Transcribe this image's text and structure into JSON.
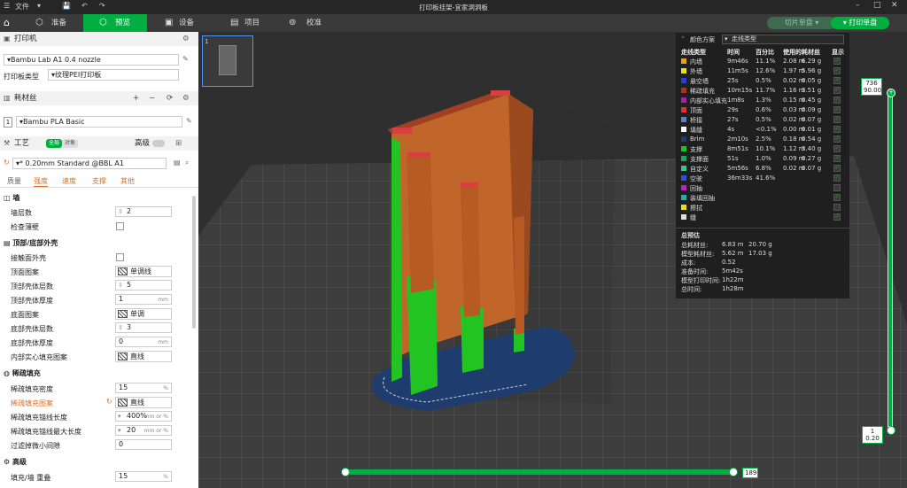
{
  "titlebar": {
    "file_menu": "文件",
    "title": "打印板挂架-宜家洞洞板"
  },
  "nav": {
    "prepare": "准备",
    "preview": "预览",
    "device": "设备",
    "project": "项目",
    "calibrate": "校准",
    "slice_plate": "切片单盘",
    "print_plate": "打印单盘"
  },
  "printer": {
    "section": "打印机",
    "name": "Bambu Lab A1 0.4 nozzle",
    "plate_label": "打印板类型",
    "plate_value": "纹理PEI打印板"
  },
  "filament": {
    "section": "耗材丝",
    "slot": "1",
    "name": "Bambu PLA Basic"
  },
  "process": {
    "section": "工艺",
    "toggle_all": "全局",
    "toggle_obj": "对象",
    "advanced": "高级",
    "preset": "* 0.20mm Standard @BBL A1",
    "tabs": [
      "质量",
      "强度",
      "速度",
      "支撑",
      "其他"
    ]
  },
  "settings": {
    "wall_group": "墙",
    "wall_loops_label": "墙层数",
    "wall_loops_value": "2",
    "thin_wall_label": "检查薄壁",
    "topbottom_group": "顶部/底部外壳",
    "top_surface_label": "接触面外壳",
    "top_pattern_label": "顶面图案",
    "top_pattern_value": "单调线",
    "top_layers_label": "顶部壳体层数",
    "top_layers_value": "5",
    "top_thick_label": "顶部壳体厚度",
    "top_thick_value": "1",
    "mm": "mm",
    "bottom_pattern_label": "底面图案",
    "bottom_pattern_value": "单调",
    "bottom_layers_label": "底部壳体层数",
    "bottom_layers_value": "3",
    "bottom_thick_label": "底部壳体厚度",
    "bottom_thick_value": "0",
    "internal_pattern_label": "内部实心填充图案",
    "internal_pattern_value": "直线",
    "infill_group": "稀疏填充",
    "infill_density_label": "稀疏填充密度",
    "infill_density_value": "15",
    "pct": "%",
    "infill_pattern_label": "稀疏填充图案",
    "infill_pattern_value": "直线",
    "anchor_len_label": "稀疏填充锚线长度",
    "anchor_len_value": "400%",
    "mm_or_pct": "mm or %",
    "anchor_max_label": "稀疏填充锚线最大长度",
    "anchor_max_value": "20",
    "filter_gap_label": "过滤掉微小间隙",
    "filter_gap_value": "0",
    "advanced_group": "高级",
    "overlap_label": "填充/墙 重叠",
    "overlap_value": "15"
  },
  "legend": {
    "scheme_label": "颜色方案",
    "scheme_value": "走线类型",
    "headers": [
      "走线类型",
      "时间",
      "百分比",
      "使用的耗材丝",
      "显示"
    ],
    "rows": [
      {
        "name": "内墙",
        "time": "9m46s",
        "pct": "11.1%",
        "len": "2.08 m",
        "wt": "6.29 g",
        "color": "#e8a020"
      },
      {
        "name": "外墙",
        "time": "11m5s",
        "pct": "12.6%",
        "len": "1.97 m",
        "wt": "5.96 g",
        "color": "#e8e020"
      },
      {
        "name": "悬空墙",
        "time": "25s",
        "pct": "0.5%",
        "len": "0.02 m",
        "wt": "0.05 g",
        "color": "#2040e0"
      },
      {
        "name": "稀疏填充",
        "time": "10m15s",
        "pct": "11.7%",
        "len": "1.16 m",
        "wt": "3.51 g",
        "color": "#b03020"
      },
      {
        "name": "内部实心填充",
        "time": "1m8s",
        "pct": "1.3%",
        "len": "0.15 m",
        "wt": "0.45 g",
        "color": "#a020b0"
      },
      {
        "name": "顶面",
        "time": "29s",
        "pct": "0.6%",
        "len": "0.03 m",
        "wt": "0.09 g",
        "color": "#e03030"
      },
      {
        "name": "桥接",
        "time": "27s",
        "pct": "0.5%",
        "len": "0.02 m",
        "wt": "0.07 g",
        "color": "#6080c0"
      },
      {
        "name": "填缝",
        "time": "4s",
        "pct": "<0.1%",
        "len": "0.00 m",
        "wt": "0.01 g",
        "color": "#ffffff"
      },
      {
        "name": "Brim",
        "time": "2m10s",
        "pct": "2.5%",
        "len": "0.18 m",
        "wt": "0.54 g",
        "color": "#203a70"
      },
      {
        "name": "支撑",
        "time": "8m51s",
        "pct": "10.1%",
        "len": "1.12 m",
        "wt": "3.40 g",
        "color": "#20c020"
      },
      {
        "name": "支撑面",
        "time": "51s",
        "pct": "1.0%",
        "len": "0.09 m",
        "wt": "0.27 g",
        "color": "#20a060"
      },
      {
        "name": "自定义",
        "time": "5m56s",
        "pct": "6.8%",
        "len": "0.02 m",
        "wt": "0.07 g",
        "color": "#40c090"
      },
      {
        "name": "空驶",
        "time": "36m33s",
        "pct": "41.6%",
        "len": "",
        "wt": "",
        "color": "#3050d0"
      },
      {
        "name": "回抽",
        "time": "",
        "pct": "",
        "len": "",
        "wt": "",
        "color": "#c020c0"
      },
      {
        "name": "装填回抽",
        "time": "",
        "pct": "",
        "len": "",
        "wt": "",
        "color": "#20b0b0"
      },
      {
        "name": "擦拭",
        "time": "",
        "pct": "",
        "len": "",
        "wt": "",
        "color": "#e0e020"
      },
      {
        "name": "缝",
        "time": "",
        "pct": "",
        "len": "",
        "wt": "",
        "color": "#e0e0e0"
      }
    ],
    "est_title": "总预估",
    "est": [
      {
        "k": "总耗材丝:",
        "v": "6.83 m",
        "v2": "20.70 g"
      },
      {
        "k": "模型耗材丝:",
        "v": "5.62 m",
        "v2": "17.03 g"
      },
      {
        "k": "成本:",
        "v": "0.52",
        "v2": ""
      },
      {
        "k": "准备时间:",
        "v": "5m42s",
        "v2": ""
      },
      {
        "k": "模型打印时间:",
        "v": "1h22m",
        "v2": ""
      },
      {
        "k": "总时间:",
        "v": "1h28m",
        "v2": ""
      }
    ]
  },
  "sliders": {
    "top_layer": "736",
    "top_height": "90.00",
    "bottom_layer": "1",
    "bottom_height": "0.20",
    "move_value": "189"
  }
}
